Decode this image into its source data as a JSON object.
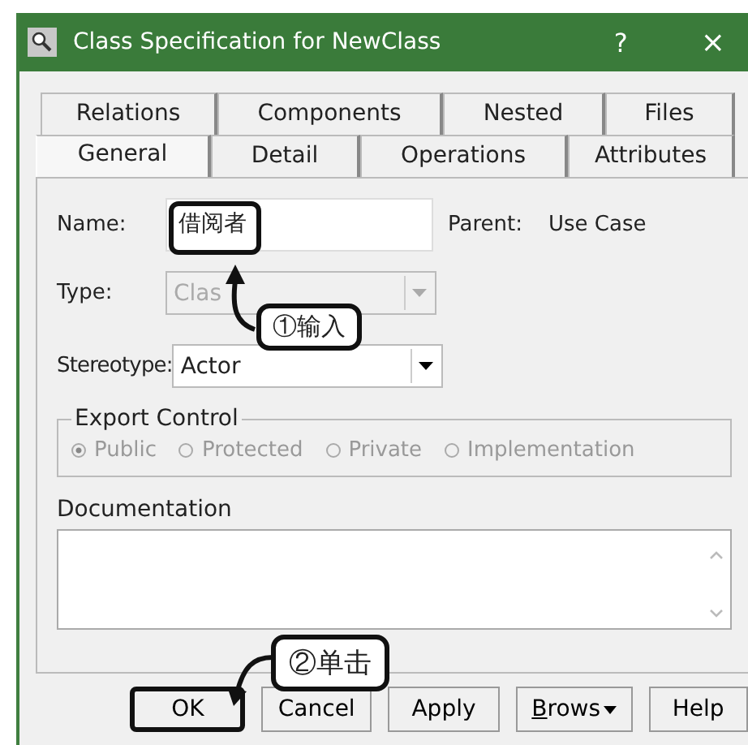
{
  "window": {
    "title": "Class Specification for NewClass",
    "help_button": "?",
    "close_button": "×"
  },
  "tabs": [
    [
      {
        "label": "Relations",
        "selected": false
      },
      {
        "label": "Components",
        "selected": false
      },
      {
        "label": "Nested",
        "selected": false
      },
      {
        "label": "Files",
        "selected": false
      }
    ],
    [
      {
        "label": "General",
        "selected": true
      },
      {
        "label": "Detail",
        "selected": false
      },
      {
        "label": "Operations",
        "selected": false
      },
      {
        "label": "Attributes",
        "selected": false
      }
    ]
  ],
  "name": {
    "label": "Name:",
    "value": "借阅者",
    "highlighted": true
  },
  "parent": {
    "label": "Parent:",
    "value": "Use Case"
  },
  "type": {
    "label": "Type:",
    "value": "Clas",
    "disabled": true
  },
  "stereotype": {
    "label": "Stereotype:",
    "value": "Actor",
    "disabled": false
  },
  "export_control": {
    "title": "Export Control",
    "disabled": true,
    "options": [
      {
        "label": "Public",
        "selected": true
      },
      {
        "label": "Protected",
        "selected": false
      },
      {
        "label": "Private",
        "selected": false
      },
      {
        "label": "Implementation",
        "selected": false
      }
    ]
  },
  "documentation": {
    "label": "Documentation"
  },
  "buttons": [
    {
      "label": "OK",
      "kind": "plain",
      "highlighted": true
    },
    {
      "label": "Cancel",
      "kind": "plain",
      "highlighted": false
    },
    {
      "label": "Apply",
      "kind": "plain",
      "highlighted": false
    },
    {
      "label": "Brows",
      "kind": "dropdown",
      "highlighted": false
    },
    {
      "label": "Help",
      "kind": "plain",
      "highlighted": false
    }
  ],
  "callouts": [
    {
      "text": "①输入"
    },
    {
      "text": "②单击"
    }
  ]
}
